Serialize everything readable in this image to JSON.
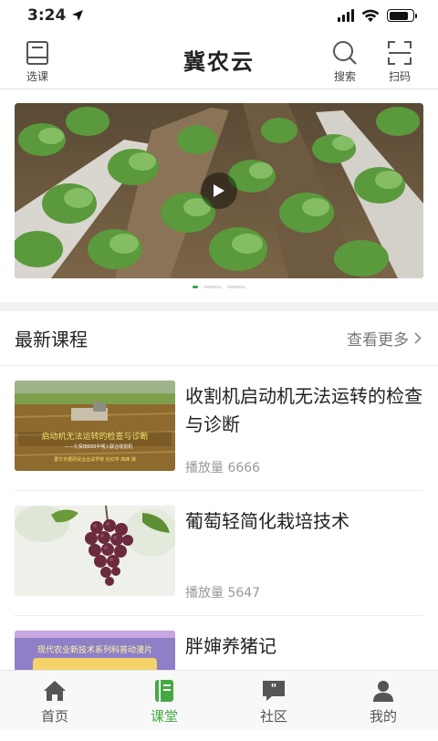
{
  "status": {
    "time": "3:24"
  },
  "header": {
    "title": "冀农云",
    "left_label": "选课",
    "search_label": "搜索",
    "scan_label": "扫码"
  },
  "banner": {
    "active_index": 0,
    "slide_count": 3
  },
  "latest": {
    "title": "最新课程",
    "more_label": "查看更多"
  },
  "courses": [
    {
      "title": "收割机启动机无法运转的检查与诊断",
      "plays_label": "播放量",
      "plays": "6666",
      "thumb_lines": [
        "启动机无法运转的检查与诊断",
        "——久保田688半喂入联合收割机",
        "晋华市晋研武业业试学校 杜红学 高峰 摄"
      ]
    },
    {
      "title": "葡萄轻简化栽培技术",
      "plays_label": "播放量",
      "plays": "5647"
    },
    {
      "title": "胖婶养猪记",
      "plays_label": "",
      "plays": "",
      "thumb_lines": [
        "现代农业新技术系列科普动漫片"
      ]
    }
  ],
  "tabs": [
    {
      "label": "首页",
      "icon": "home-icon"
    },
    {
      "label": "课堂",
      "icon": "book-icon",
      "active": true
    },
    {
      "label": "社区",
      "icon": "chat-icon"
    },
    {
      "label": "我的",
      "icon": "user-icon"
    }
  ],
  "colors": {
    "accent": "#45a842",
    "text": "#222222",
    "muted": "#999999"
  }
}
